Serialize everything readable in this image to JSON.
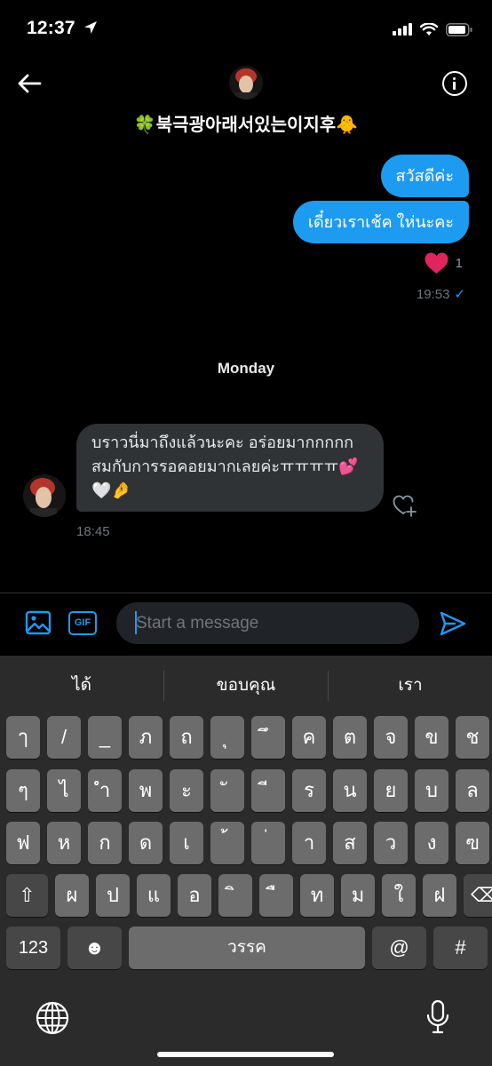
{
  "status_bar": {
    "time": "12:37",
    "location_icon": "location-arrow-icon",
    "signal_icon": "cellular-signal-icon",
    "wifi_icon": "wifi-icon",
    "battery_icon": "battery-icon"
  },
  "header": {
    "back_icon": "back-arrow-icon",
    "info_icon": "info-icon",
    "name": "🍀북극광아래서있는이지후🐥"
  },
  "messages": {
    "outgoing": [
      {
        "text": "สวัสดีค่ะ"
      },
      {
        "text": "เดี๋ยวเราเช้ค ให่นะคะ"
      }
    ],
    "reaction_count": "1",
    "outgoing_time": "19:53",
    "read_check": "✓",
    "date_separator": "Monday",
    "incoming": {
      "text": "บราวนี่มาถึงแล้วนะคะ อร่อยมากกกกก สมกับการรอคอยมากเลยค่ะㅠㅠㅠㅠ💕🤍🤌",
      "time": "18:45"
    }
  },
  "composer": {
    "image_icon": "image-icon",
    "gif_label": "GIF",
    "placeholder": "Start a message",
    "send_icon": "send-icon"
  },
  "keyboard": {
    "suggestions": [
      "ได้",
      "ขอบคุณ",
      "เรา"
    ],
    "row1": [
      "ๅ",
      "/",
      "_",
      "ภ",
      "ถ",
      "ุ",
      "ึ",
      "ค",
      "ต",
      "จ",
      "ข",
      "ช"
    ],
    "row2": [
      "ๆ",
      "ไ",
      "ำ",
      "พ",
      "ะ",
      "ั",
      "ี",
      "ร",
      "น",
      "ย",
      "บ",
      "ล"
    ],
    "row3": [
      "ฟ",
      "ห",
      "ก",
      "ด",
      "เ",
      "้",
      "่",
      "า",
      "ส",
      "ว",
      "ง",
      "ฃ"
    ],
    "row4": [
      "ผ",
      "ป",
      "แ",
      "อ",
      "ิ",
      "ื",
      "ท",
      "ม",
      "ใ",
      "ฝ"
    ],
    "shift_label": "⇧",
    "delete_label": "⌫",
    "numbers_label": "123",
    "emoji_label": "☻",
    "space_label": "วรรค",
    "at_label": "@",
    "hash_label": "#",
    "globe_icon": "globe-icon",
    "mic_icon": "microphone-icon"
  }
}
